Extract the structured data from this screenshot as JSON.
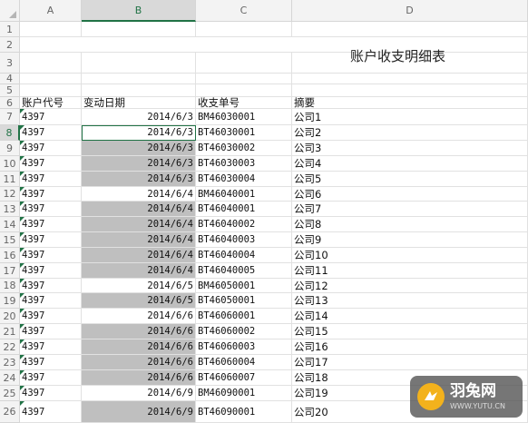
{
  "columns": [
    "A",
    "B",
    "C",
    "D"
  ],
  "row_numbers": [
    "1",
    "2",
    "3",
    "4",
    "5",
    "6",
    "7",
    "8",
    "9",
    "10",
    "11",
    "12",
    "13",
    "14",
    "15",
    "16",
    "17",
    "18",
    "19",
    "20",
    "21",
    "22",
    "23",
    "24",
    "25",
    "26"
  ],
  "title": "账户收支明细表",
  "header_row": {
    "account": "账户代号",
    "date": "变动日期",
    "doc_no": "收支单号",
    "summary": "摘要"
  },
  "rows": [
    {
      "account": "4397",
      "date": "2014/6/3",
      "doc_no": "BM46030001",
      "summary": "公司1",
      "shaded": false
    },
    {
      "account": "4397",
      "date": "2014/6/3",
      "doc_no": "BT46030001",
      "summary": "公司2",
      "shaded": false,
      "active": true
    },
    {
      "account": "4397",
      "date": "2014/6/3",
      "doc_no": "BT46030002",
      "summary": "公司3",
      "shaded": true
    },
    {
      "account": "4397",
      "date": "2014/6/3",
      "doc_no": "BT46030003",
      "summary": "公司4",
      "shaded": true
    },
    {
      "account": "4397",
      "date": "2014/6/3",
      "doc_no": "BT46030004",
      "summary": "公司5",
      "shaded": true
    },
    {
      "account": "4397",
      "date": "2014/6/4",
      "doc_no": "BM46040001",
      "summary": "公司6",
      "shaded": false
    },
    {
      "account": "4397",
      "date": "2014/6/4",
      "doc_no": "BT46040001",
      "summary": "公司7",
      "shaded": true
    },
    {
      "account": "4397",
      "date": "2014/6/4",
      "doc_no": "BT46040002",
      "summary": "公司8",
      "shaded": true
    },
    {
      "account": "4397",
      "date": "2014/6/4",
      "doc_no": "BT46040003",
      "summary": "公司9",
      "shaded": true
    },
    {
      "account": "4397",
      "date": "2014/6/4",
      "doc_no": "BT46040004",
      "summary": "公司10",
      "shaded": true
    },
    {
      "account": "4397",
      "date": "2014/6/4",
      "doc_no": "BT46040005",
      "summary": "公司11",
      "shaded": true
    },
    {
      "account": "4397",
      "date": "2014/6/5",
      "doc_no": "BM46050001",
      "summary": "公司12",
      "shaded": false
    },
    {
      "account": "4397",
      "date": "2014/6/5",
      "doc_no": "BT46050001",
      "summary": "公司13",
      "shaded": true
    },
    {
      "account": "4397",
      "date": "2014/6/6",
      "doc_no": "BT46060001",
      "summary": "公司14",
      "shaded": false
    },
    {
      "account": "4397",
      "date": "2014/6/6",
      "doc_no": "BT46060002",
      "summary": "公司15",
      "shaded": true
    },
    {
      "account": "4397",
      "date": "2014/6/6",
      "doc_no": "BT46060003",
      "summary": "公司16",
      "shaded": true
    },
    {
      "account": "4397",
      "date": "2014/6/6",
      "doc_no": "BT46060004",
      "summary": "公司17",
      "shaded": true
    },
    {
      "account": "4397",
      "date": "2014/6/6",
      "doc_no": "BT46060007",
      "summary": "公司18",
      "shaded": true
    },
    {
      "account": "4397",
      "date": "2014/6/9",
      "doc_no": "BM46090001",
      "summary": "公司19",
      "shaded": false
    },
    {
      "account": "4397",
      "date": "2014/6/9",
      "doc_no": "BT46090001",
      "summary": "公司20",
      "shaded": true
    }
  ],
  "selection": {
    "column": "B",
    "row": "8"
  },
  "colors": {
    "accent": "#217346",
    "shade": "#bfbfbf",
    "header_bg": "#f3f3f3"
  },
  "watermark": {
    "text": "羽兔网",
    "url": "WWW.YUTU.CN",
    "icon": "rabbit-logo-icon"
  }
}
